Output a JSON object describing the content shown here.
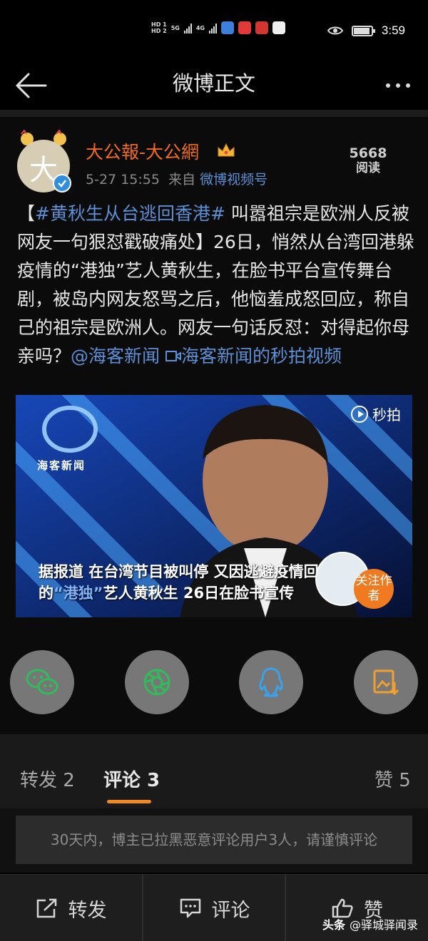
{
  "status_bar": {
    "hd1": "HD 1",
    "hd2": "HD 2",
    "net1": "5G",
    "net2": "4G",
    "time": "3:59",
    "battery_level": 0.9
  },
  "nav": {
    "title": "微博正文"
  },
  "post": {
    "author": "大公報-大公網",
    "avatar_char": "大",
    "date": "5-27 15:55",
    "source_prefix": "来自",
    "source": "微博视频号",
    "read_count": "5668",
    "read_label": "阅读",
    "text_open": "【",
    "hashtag": "#黄秋生从台逃回香港#",
    "text_body": " 叫嚣祖宗是欧洲人反被网友一句狠怼戳破痛处】26日，悄然从台湾回港躲疫情的“港独”艺人黄秋生，在脸书平台宣传舞台剧，被岛内网友怒骂之后，他恼羞成怒回应，称自己的祖宗是欧洲人。网友一句话反怼：对得起你母亲吗？",
    "mention": "@海客新闻",
    "video_link": "海客新闻的秒拍视频"
  },
  "video": {
    "brand": "秒拍",
    "logo_text": "海客新闻",
    "caption_line1": "据报道 在台湾节目被叫停 又因逃避疫情回港",
    "caption_line2_pre": "的",
    "caption_line2_hl": "“港独”",
    "caption_line2_post": "艺人黄秋生 26日在脸书宣传",
    "follow_label": "关注作者"
  },
  "share": {
    "items": [
      "wechat-icon",
      "moments-icon",
      "qq-icon",
      "save-image-icon"
    ]
  },
  "tabs": {
    "repost": "转发 2",
    "comment": "评论 3",
    "like": "赞 5"
  },
  "notice": "30天内，博主已拉黑恶意评论用户3人，请谨慎评论",
  "bottom_bar": {
    "repost": "转发",
    "comment": "评论",
    "like": "赞"
  },
  "watermark": {
    "logo": "头条",
    "account": "@驿城驿闻录"
  },
  "colors": {
    "accent": "#f08a1c",
    "author": "#f26a1b",
    "link": "#5b8fd6",
    "share_button": "#777777"
  }
}
